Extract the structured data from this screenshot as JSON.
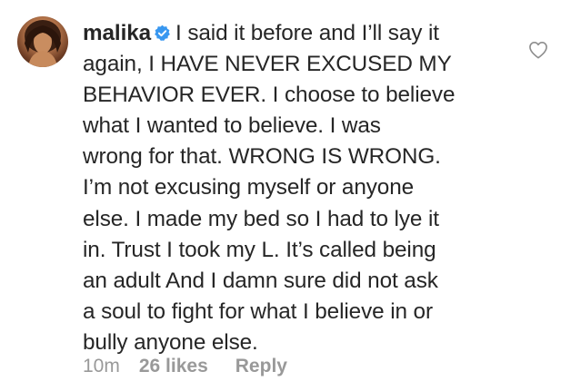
{
  "comment": {
    "username": "malika",
    "text_lines": [
      "I said it before and I’ll say it",
      "again, I HAVE NEVER EXCUSED MY",
      "BEHAVIOR EVER. I choose to believe",
      "what I wanted to believe. I was",
      "wrong for that. WRONG IS WRONG.",
      "I’m not excusing myself or anyone",
      "else. I made my bed so I had to lye it",
      "in. Trust I took my L. It’s called being",
      "an adult And I damn sure did not ask",
      "a soul to fight for what I believe in or",
      "bully anyone else."
    ],
    "time": "10m",
    "likes": "26 likes",
    "reply_label": "Reply",
    "verified_icon": "verified-badge-icon",
    "like_icon": "heart-outline-icon",
    "colors": {
      "text": "#262626",
      "meta": "#999999",
      "verified": "#3897f0",
      "heart": "#8e8e8e"
    }
  }
}
